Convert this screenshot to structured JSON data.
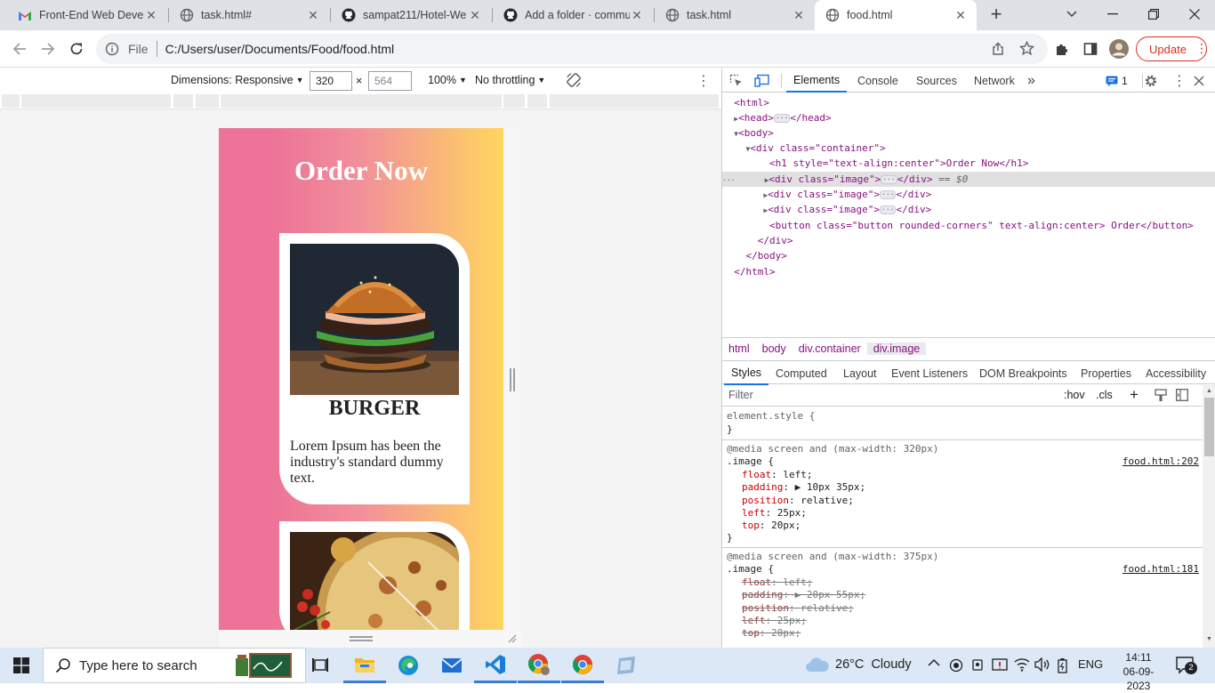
{
  "browser": {
    "tabs": [
      {
        "title": "Front-End Web Develo",
        "icon": "gmail-icon"
      },
      {
        "title": "task.html#",
        "icon": "globe-icon"
      },
      {
        "title": "sampat211/Hotel-We",
        "icon": "github-icon"
      },
      {
        "title": "Add a folder · commu",
        "icon": "github-icon"
      },
      {
        "title": "task.html",
        "icon": "globe-icon"
      },
      {
        "title": "food.html",
        "icon": "globe-icon",
        "active": true
      }
    ],
    "address": {
      "scheme_label": "File",
      "url": "C:/Users/user/Documents/Food/food.html"
    },
    "update_label": "Update"
  },
  "device_toolbar": {
    "dimensions_label": "Dimensions: Responsive",
    "width": "320",
    "height_placeholder": "564",
    "times": "×",
    "zoom": "100%",
    "throttling": "No throttling"
  },
  "page": {
    "heading": "Order Now",
    "cards": [
      {
        "name": "BURGER",
        "description": "Lorem Ipsum has been the industry's standard dummy text."
      },
      {
        "name": "",
        "description": ""
      }
    ]
  },
  "devtools": {
    "tabs": [
      "Elements",
      "Console",
      "Sources",
      "Network"
    ],
    "more_tabs": "»",
    "issues_count": "1",
    "dom": {
      "html_open": "<html>",
      "head": "<head>",
      "head_close": "</head>",
      "body_open": "<body>",
      "container_open": "<div class=\"container\">",
      "h1": "<h1 style=\"text-align:center\">Order Now</h1>",
      "image_div": "<div class=\"image\">",
      "div_close": "</div>",
      "selected_marker": "== $0",
      "button": "<button class=\"button rounded-corners\" text-align:center> Order</button>",
      "container_close": "</div>",
      "body_close": "</body>",
      "html_close": "</html>"
    },
    "breadcrumbs": [
      "html",
      "body",
      "div.container",
      "div.image"
    ],
    "styles_tabs": [
      "Styles",
      "Computed",
      "Layout",
      "Event Listeners",
      "DOM Breakpoints",
      "Properties",
      "Accessibility"
    ],
    "filter_placeholder": "Filter",
    "filter_tools": [
      ":hov",
      ".cls",
      "+"
    ],
    "rules": {
      "element_style": "element.style {",
      "close_brace": "}",
      "media1": "@media screen and (max-width: 320px)",
      "selector1": ".image {",
      "source1": "food.html:202",
      "props1": [
        {
          "name": "float",
          "value": "left;"
        },
        {
          "name": "padding",
          "value": "▶ 10px 35px;"
        },
        {
          "name": "position",
          "value": "relative;"
        },
        {
          "name": "left",
          "value": "25px;"
        },
        {
          "name": "top",
          "value": "20px;"
        }
      ],
      "media2": "@media screen and (max-width: 375px)",
      "selector2": ".image {",
      "source2": "food.html:181",
      "props2": [
        {
          "name": "float",
          "value": "left;"
        },
        {
          "name": "padding",
          "value": "▶ 20px 55px;"
        },
        {
          "name": "position",
          "value": "relative;"
        },
        {
          "name": "left",
          "value": "25px;"
        },
        {
          "name": "top",
          "value": "20px;"
        }
      ]
    }
  },
  "taskbar": {
    "search_placeholder": "Type here to search",
    "weather": "26°C  Cloudy",
    "language": "ENG",
    "time": "14:11",
    "date": "06-09-2023",
    "notifications": "2"
  }
}
